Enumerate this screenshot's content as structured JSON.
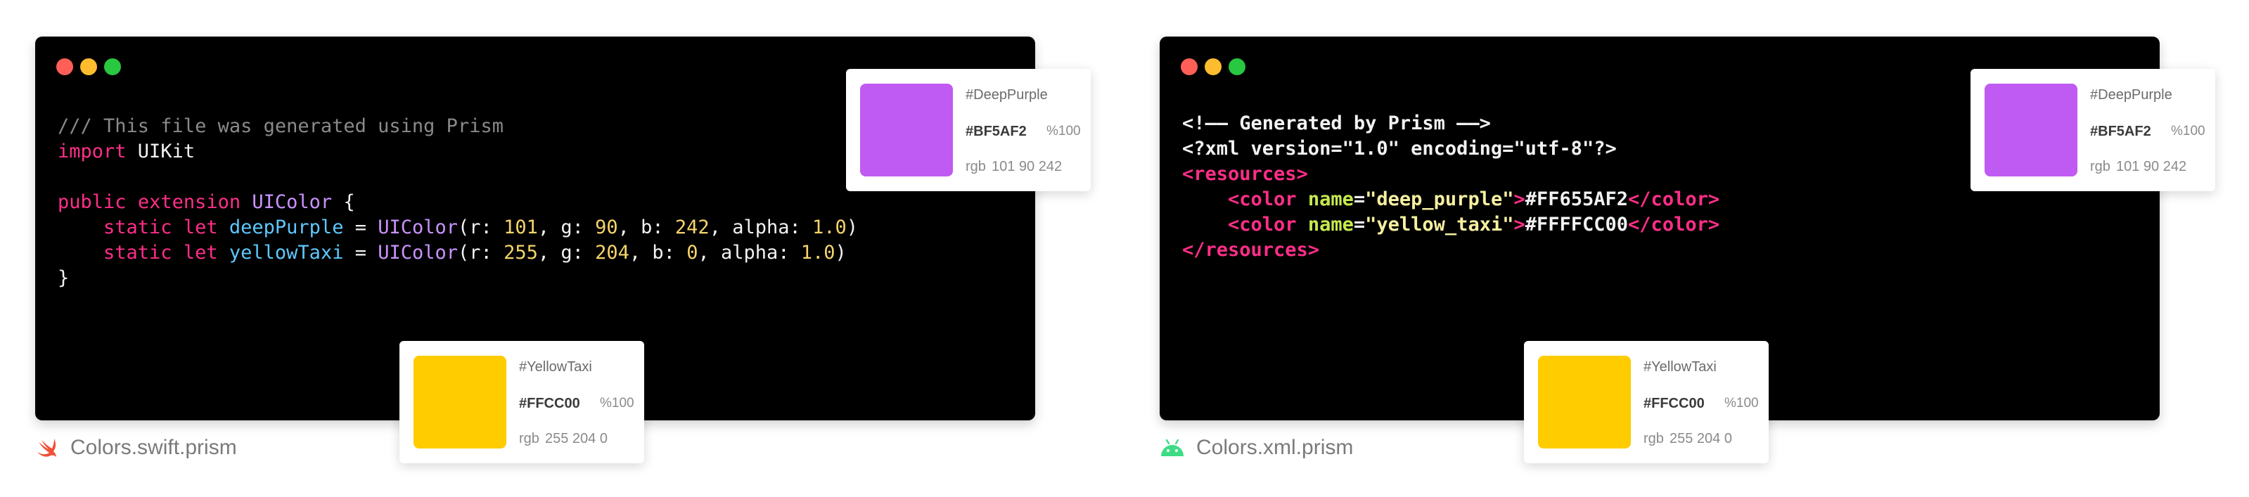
{
  "panels": {
    "swift": {
      "file": {
        "icon": "swift-icon",
        "name": "Colors.swift.prism",
        "icon_color": "#f05138"
      },
      "code_lines": [
        [
          [
            "comment",
            "/// This file was generated using Prism"
          ]
        ],
        [
          [
            "kw",
            "import"
          ],
          [
            "plain",
            " UIKit"
          ]
        ],
        [],
        [
          [
            "kw",
            "public"
          ],
          [
            "plain",
            " "
          ],
          [
            "kw",
            "extension"
          ],
          [
            "plain",
            " "
          ],
          [
            "type",
            "UIColor"
          ],
          [
            "plain",
            " {"
          ]
        ],
        [
          [
            "plain",
            "    "
          ],
          [
            "kw",
            "static"
          ],
          [
            "plain",
            " "
          ],
          [
            "kw",
            "let"
          ],
          [
            "plain",
            " "
          ],
          [
            "prop",
            "deepPurple"
          ],
          [
            "plain",
            " = "
          ],
          [
            "func",
            "UIColor"
          ],
          [
            "plain",
            "(r: "
          ],
          [
            "num",
            "101"
          ],
          [
            "plain",
            ", g: "
          ],
          [
            "num",
            "90"
          ],
          [
            "plain",
            ", b: "
          ],
          [
            "num",
            "242"
          ],
          [
            "plain",
            ", alpha: "
          ],
          [
            "num",
            "1.0"
          ],
          [
            "plain",
            ")"
          ]
        ],
        [
          [
            "plain",
            "    "
          ],
          [
            "kw",
            "static"
          ],
          [
            "plain",
            " "
          ],
          [
            "kw",
            "let"
          ],
          [
            "plain",
            " "
          ],
          [
            "prop",
            "yellowTaxi"
          ],
          [
            "plain",
            " = "
          ],
          [
            "func",
            "UIColor"
          ],
          [
            "plain",
            "(r: "
          ],
          [
            "num",
            "255"
          ],
          [
            "plain",
            ", g: "
          ],
          [
            "num",
            "204"
          ],
          [
            "plain",
            ", b: "
          ],
          [
            "num",
            "0"
          ],
          [
            "plain",
            ", alpha: "
          ],
          [
            "num",
            "1.0"
          ],
          [
            "plain",
            ")"
          ]
        ],
        [
          [
            "plain",
            "}"
          ]
        ]
      ]
    },
    "xml": {
      "file": {
        "icon": "android-icon",
        "name": "Colors.xml.prism",
        "icon_color": "#3ddc84"
      },
      "code_lines": [
        [
          [
            "plain",
            "<!—— Generated by Prism ——>"
          ]
        ],
        [
          [
            "plain",
            "<?xml version=\"1.0\" encoding=\"utf-8\"?>"
          ]
        ],
        [
          [
            "tag",
            "<resources>"
          ]
        ],
        [
          [
            "plain",
            "    "
          ],
          [
            "tag",
            "<color"
          ],
          [
            "plain",
            " "
          ],
          [
            "attr",
            "name"
          ],
          [
            "plain",
            "="
          ],
          [
            "str",
            "\"deep_purple\""
          ],
          [
            "tag",
            ">"
          ],
          [
            "plain",
            "#FF655AF2"
          ],
          [
            "tag",
            "</color>"
          ]
        ],
        [
          [
            "plain",
            "    "
          ],
          [
            "tag",
            "<color"
          ],
          [
            "plain",
            " "
          ],
          [
            "attr",
            "name"
          ],
          [
            "plain",
            "="
          ],
          [
            "str",
            "\"yellow_taxi\""
          ],
          [
            "tag",
            ">"
          ],
          [
            "plain",
            "#FFFFCC00"
          ],
          [
            "tag",
            "</color>"
          ]
        ],
        [
          [
            "tag",
            "</resources>"
          ]
        ]
      ]
    }
  },
  "colors": {
    "deep_purple": {
      "name": "#DeepPurple",
      "hex": "#BF5AF2",
      "alpha": "%100",
      "rgb_label": "rgb",
      "rgb_values": "101 90 242",
      "swatch": "#BF5AF2"
    },
    "yellow_taxi": {
      "name": "#YellowTaxi",
      "hex": "#FFCC00",
      "alpha": "%100",
      "rgb_label": "rgb",
      "rgb_values": "255 204 0",
      "swatch": "#FFCC00"
    }
  }
}
